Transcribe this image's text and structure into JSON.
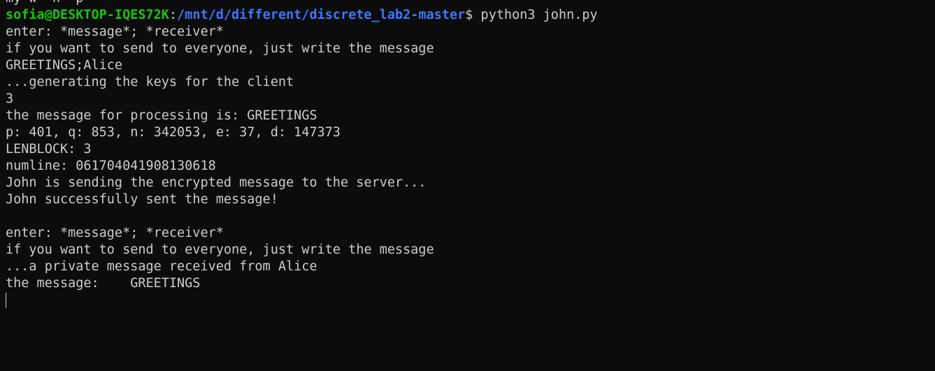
{
  "window": {
    "clipped_top_line": "my w  n  p"
  },
  "prompt": {
    "user_host": "sofia@DESKTOP-IQES72K",
    "colon": ":",
    "path": "/mnt/d/different/discrete_lab2-master",
    "dollar": "$",
    "command": " python3 john.py"
  },
  "output": [
    "enter: *message*; *receiver*",
    "if you want to send to everyone, just write the message",
    "GREETINGS;Alice",
    "...generating the keys for the client",
    "3",
    "the message for processing is: GREETINGS",
    "p: 401, q: 853, n: 342053, e: 37, d: 147373",
    "LENBLOCK: 3",
    "numline: 061704041908130618",
    "John is sending the encrypted message to the server...",
    "John successfully sent the message!",
    "",
    "enter: *message*; *receiver*",
    "if you want to send to everyone, just write the message",
    "...a private message received from Alice",
    "the message:    GREETINGS"
  ]
}
